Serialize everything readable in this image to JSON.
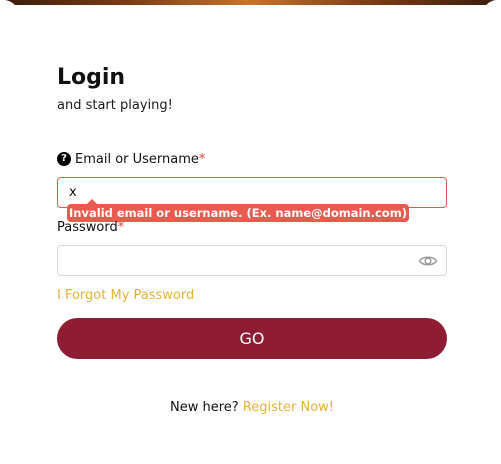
{
  "login": {
    "title": "Login",
    "subtitle": "and start playing!",
    "help_icon": "question-circle-icon",
    "email": {
      "label": "Email or Username",
      "required_marker": "*",
      "value": "x",
      "error": "Invalid email or username. (Ex. name@domain.com)"
    },
    "password": {
      "label": "Password",
      "required_marker": "*",
      "value": "",
      "toggle_icon": "eye-icon"
    },
    "forgot_link": "I Forgot My Password",
    "submit_label": "GO",
    "register": {
      "prompt": "New here?",
      "link": "Register Now!"
    }
  },
  "colors": {
    "accent": "#e8b23a",
    "button": "#8e1c33",
    "error": "#ea5a4f"
  }
}
